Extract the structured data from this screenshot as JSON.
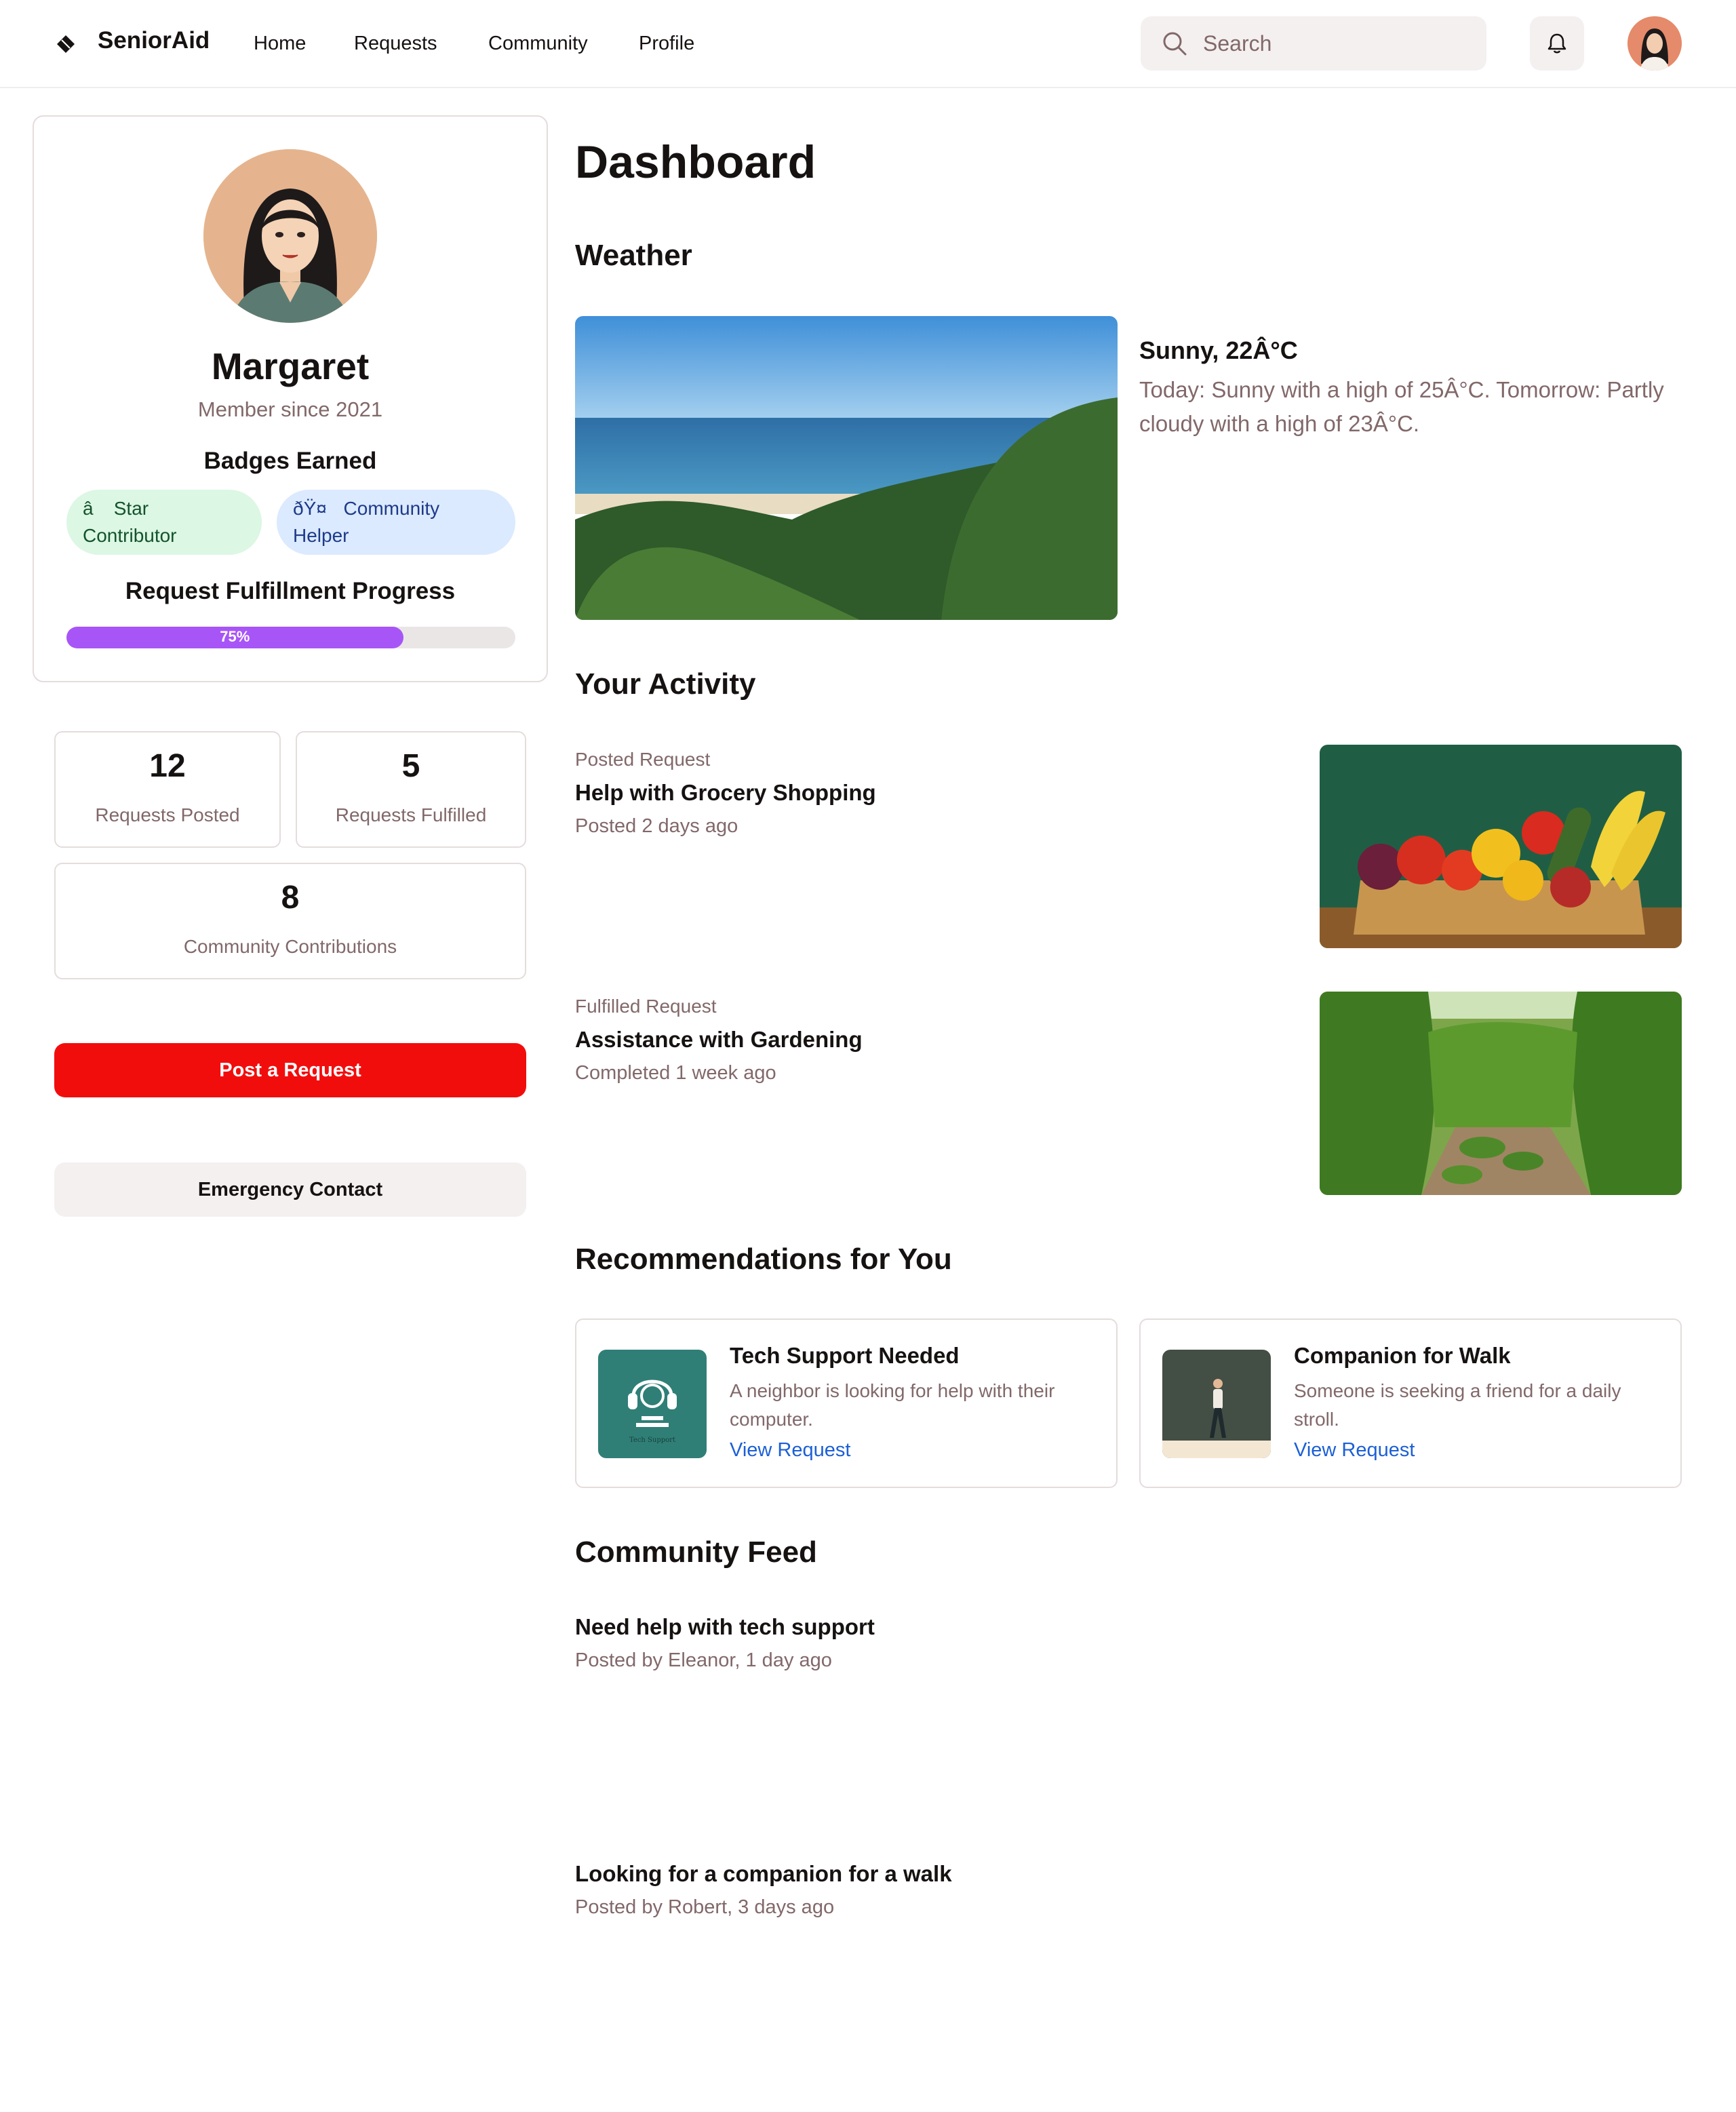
{
  "header": {
    "brand": "SeniorAid",
    "nav": [
      "Home",
      "Requests",
      "Community",
      "Profile"
    ],
    "search_placeholder": "Search"
  },
  "profile": {
    "name": "Margaret",
    "member_since": "Member since 2021",
    "badges_title": "Badges Earned",
    "badges": [
      "â­ Star Contributor",
      "ðŸ¤ Community Helper"
    ],
    "progress_title": "Request Fulfillment Progress",
    "progress_label": "75%",
    "progress_fraction": 0.75
  },
  "stats": [
    {
      "value": "12",
      "label": "Requests Posted"
    },
    {
      "value": "5",
      "label": "Requests Fulfilled"
    },
    {
      "value": "8",
      "label": "Community Contributions"
    }
  ],
  "actions": {
    "post_request": "Post a Request",
    "emergency_contact": "Emergency Contact"
  },
  "main": {
    "title": "Dashboard",
    "weather": {
      "heading": "Weather",
      "title": "Sunny, 22Â°C",
      "description": "Today: Sunny with a high of 25Â°C. Tomorrow: Partly cloudy with a high of 23Â°C."
    },
    "activity": {
      "heading": "Your Activity",
      "items": [
        {
          "type": "Posted Request",
          "title": "Help with Grocery Shopping",
          "time": "Posted 2 days ago"
        },
        {
          "type": "Fulfilled Request",
          "title": "Assistance with Gardening",
          "time": "Completed 1 week ago"
        }
      ]
    },
    "recommendations": {
      "heading": "Recommendations for You",
      "items": [
        {
          "title": "Tech Support Needed",
          "description": "A neighbor is looking for help with their computer.",
          "link": "View Request",
          "thumb_caption": "Tech Support"
        },
        {
          "title": "Companion for Walk",
          "description": "Someone is seeking a friend for a daily stroll.",
          "link": "View Request"
        }
      ]
    },
    "feed": {
      "heading": "Community Feed",
      "items": [
        {
          "title": "Need help with tech support",
          "meta": "Posted by Eleanor, 1 day ago"
        },
        {
          "title": "Looking for a companion for a walk",
          "meta": "Posted by Robert, 3 days ago"
        }
      ]
    }
  },
  "colors": {
    "primary_red": "#f20d0d",
    "progress_purple": "#a855f7",
    "muted_text": "#82686a",
    "link_blue": "#1c5fd6"
  }
}
